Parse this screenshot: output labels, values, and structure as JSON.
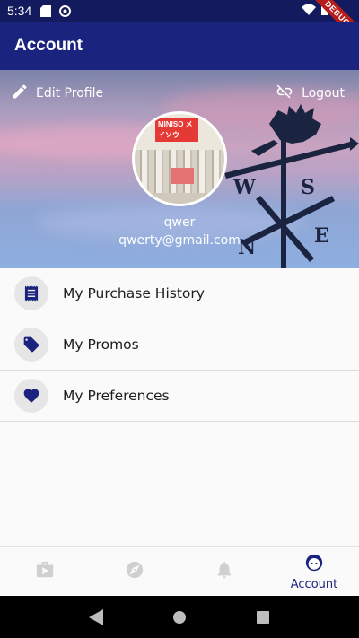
{
  "status_bar": {
    "time": "5:34",
    "debug_label": "DEBUG"
  },
  "app_bar": {
    "title": "Account"
  },
  "header": {
    "edit_profile_label": "Edit Profile",
    "logout_label": "Logout",
    "avatar_logo_text": "MINISO メイソウ",
    "name": "qwer",
    "email": "qwerty@gmail.com"
  },
  "menu": {
    "items": [
      {
        "label": "My Purchase History",
        "icon": "receipt-icon"
      },
      {
        "label": "My Promos",
        "icon": "tag-icon"
      },
      {
        "label": "My Preferences",
        "icon": "heart-icon"
      }
    ]
  },
  "bottom_nav": {
    "items": [
      {
        "label": "",
        "icon": "shop-icon",
        "active": false
      },
      {
        "label": "",
        "icon": "compass-icon",
        "active": false
      },
      {
        "label": "",
        "icon": "bell-icon",
        "active": false
      },
      {
        "label": "Account",
        "icon": "face-icon",
        "active": true
      }
    ]
  },
  "colors": {
    "primary": "#1a237e",
    "status_bar": "#131a5e",
    "inactive_icon": "#d0d0d0",
    "debug_ribbon": "#b71c1c"
  }
}
